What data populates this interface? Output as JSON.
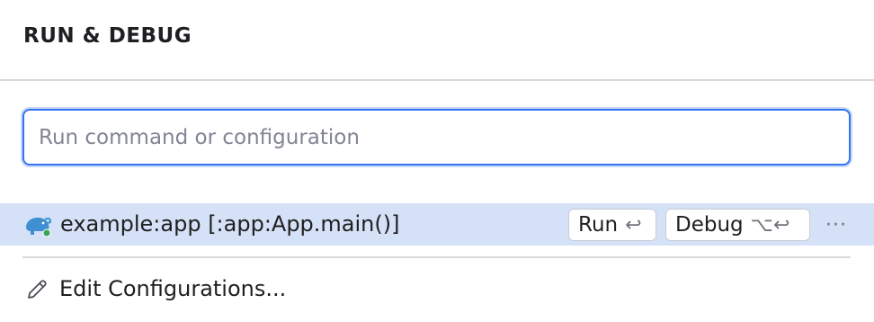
{
  "panel": {
    "title": "RUN & DEBUG"
  },
  "search": {
    "placeholder": "Run command or configuration",
    "value": ""
  },
  "configurations": [
    {
      "icon": "gradle-elephant-icon",
      "label": "example:app [:app:App.main()]",
      "run_label": "Run",
      "run_shortcut": "↩",
      "debug_label": "Debug",
      "debug_shortcut": "⌥↩",
      "more_label": "···"
    }
  ],
  "edit": {
    "icon": "pencil-icon",
    "label": "Edit Configurations..."
  },
  "colors": {
    "accent": "#3574f0",
    "selected_row": "#d5e1f7",
    "separator": "#d8d9dc",
    "gradle": "#02303a",
    "gradle_fill": "#3f8fd2",
    "status_dot": "#3aa35a"
  }
}
